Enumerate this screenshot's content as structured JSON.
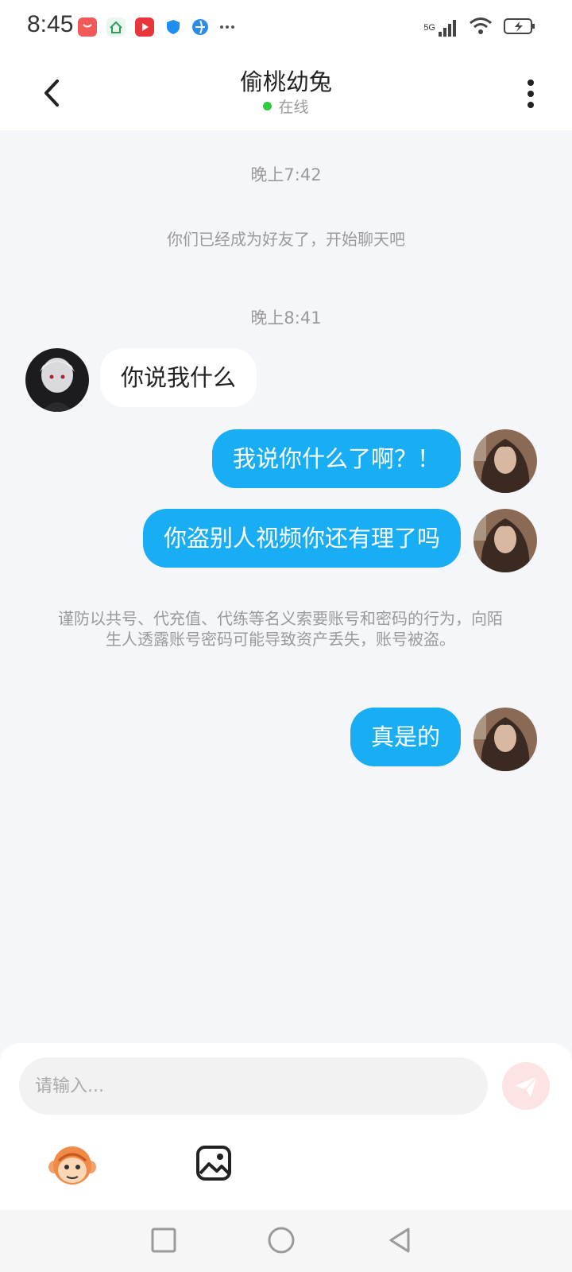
{
  "status_bar": {
    "time": "8:45",
    "network": "5G",
    "icons": [
      "shopping-bag-icon",
      "home-app-icon",
      "video-app-icon",
      "shield-app-icon",
      "browser-app-icon",
      "more-dots-icon",
      "signal-icon",
      "wifi-icon",
      "battery-icon"
    ]
  },
  "header": {
    "title": "偷桃幼兔",
    "status": "在线"
  },
  "chat": {
    "time1": "晚上7:42",
    "system_friend": "你们已经成为好友了，开始聊天吧",
    "time2": "晚上8:41",
    "messages": [
      {
        "side": "in",
        "text": "你说我什么"
      },
      {
        "side": "out",
        "text": "我说你什么了啊？！"
      },
      {
        "side": "out",
        "text": "你盗别人视频你还有理了吗"
      },
      {
        "side": "out",
        "text": "真是的"
      }
    ],
    "security_notice": "谨防以共号、代充值、代练等名义索要账号和密码的行为，向陌生人透露账号密码可能导致资产丢失，账号被盗。"
  },
  "input": {
    "placeholder": "请输入...",
    "send_icon": "send-plane-icon",
    "emoji_icon": "monkey-emoji-icon",
    "image_icon": "image-icon"
  },
  "nav": {
    "icons": [
      "square-recent-icon",
      "circle-home-icon",
      "triangle-back-icon"
    ]
  },
  "colors": {
    "out_bubble": "#19adf3",
    "in_bubble": "#ffffff",
    "chat_bg": "#f4f6f9",
    "online": "#2ecc40"
  }
}
